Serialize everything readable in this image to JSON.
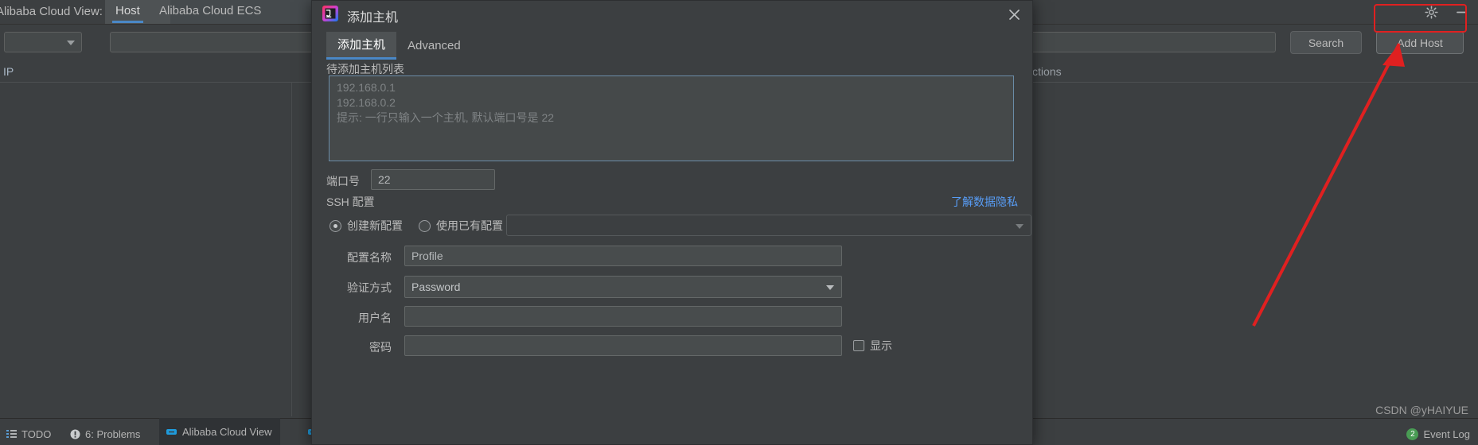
{
  "toolwindow": {
    "title": "Alibaba Cloud View:",
    "tabs": [
      {
        "label": "Host",
        "active": true
      },
      {
        "label": "Alibaba Cloud ECS",
        "active": false
      }
    ],
    "icons": {
      "settings": "gear-icon",
      "minimize": "minimize-icon"
    }
  },
  "filter": {
    "combo_value": "",
    "search_placeholder": "",
    "search_value": "",
    "search_button": "Search",
    "add_host_button": "Add Host"
  },
  "table": {
    "columns": [
      {
        "label": "IP"
      },
      {
        "label": "ctions"
      }
    ]
  },
  "dialog": {
    "title": "添加主机",
    "icon": "intellij-idea-icon",
    "close_icon": "close-icon",
    "tabs": [
      {
        "label": "添加主机",
        "active": true
      },
      {
        "label": "Advanced",
        "active": false
      }
    ],
    "host_list_label": "待添加主机列表",
    "host_list_placeholder": [
      "192.168.0.1",
      "192.168.0.2",
      "提示: 一行只输入一个主机, 默认端口号是 22"
    ],
    "host_list_value": "",
    "port_label": "端口号",
    "port_value": "22",
    "ssh_section_label": "SSH 配置",
    "privacy_link": "了解数据隐私",
    "radio_new": "创建新配置",
    "radio_existing": "使用已有配置",
    "radio_selected": "创建新配置",
    "existing_profile_value": "",
    "fields": {
      "profile_name_label": "配置名称",
      "profile_name_value": "Profile",
      "auth_type_label": "验证方式",
      "auth_type_value": "Password",
      "username_label": "用户名",
      "username_value": "",
      "password_label": "密码",
      "password_value": "",
      "show_password_label": "显示"
    }
  },
  "status_bar": {
    "todo": "TODO",
    "problems": "6: Problems",
    "alibaba_cloud_view": "Alibaba Cloud View",
    "event_log": "Event Log",
    "event_log_count": "2"
  },
  "watermark": "CSDN @yHAIYUE",
  "colors": {
    "accent": "#4a88c7",
    "link": "#589df6",
    "annotation": "#e02020",
    "background": "#3c3f41"
  }
}
